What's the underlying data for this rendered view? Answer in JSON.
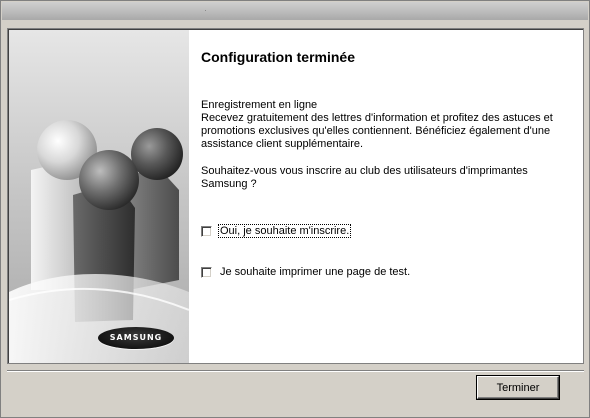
{
  "window": {
    "title": ""
  },
  "header": {
    "title": "Configuration terminée"
  },
  "body": {
    "paragraph1_line1": "Enregistrement en ligne",
    "paragraph1_rest": "Recevez gratuitement des lettres d'information et profitez des astuces et promotions exclusives qu'elles contiennent. Bénéficiez également d'une assistance client supplémentaire.",
    "paragraph2": "Souhaitez-vous vous inscrire au club des utilisateurs d'imprimantes Samsung ?"
  },
  "options": [
    {
      "label": "Oui, je souhaite m'inscrire.",
      "checked": false,
      "focused": true
    },
    {
      "label": "Je souhaite imprimer une page de test.",
      "checked": false,
      "focused": false
    }
  ],
  "branding": {
    "logo_text": "SAMSUNG"
  },
  "footer": {
    "finish_label": "Terminer"
  },
  "colors": {
    "dialog_face": "#d4d0c8",
    "panel_bg": "#ffffff",
    "art_bg": "#c9c9c9"
  }
}
